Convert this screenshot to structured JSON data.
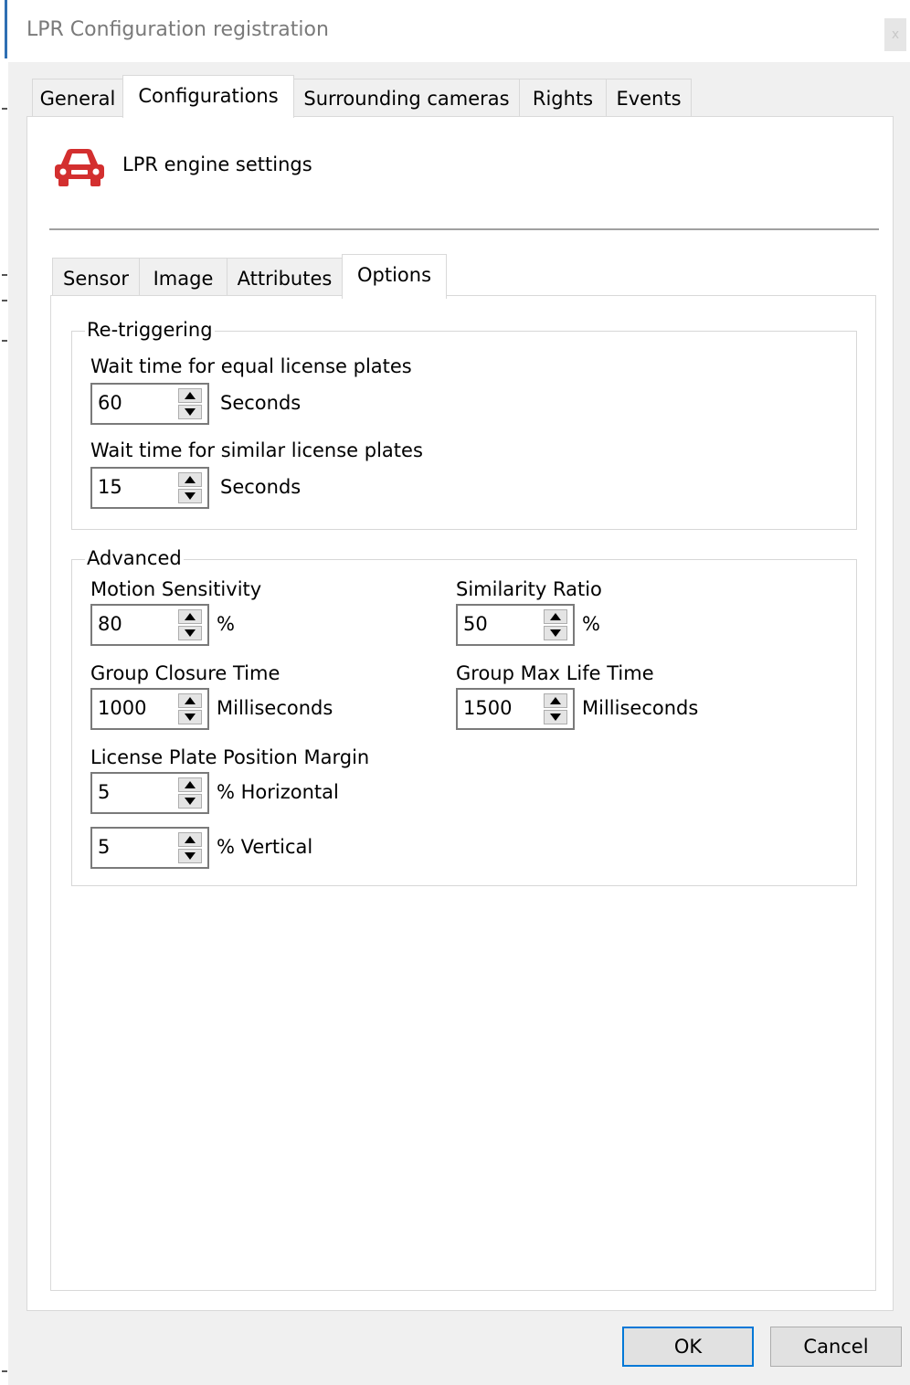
{
  "window": {
    "title": "LPR Configuration registration",
    "close_glyph": "x"
  },
  "outer_tabs": [
    "General",
    "Configurations",
    "Surrounding cameras",
    "Rights",
    "Events"
  ],
  "header": {
    "title": "LPR engine settings",
    "icon": "car-icon",
    "icon_color": "#d32f2f"
  },
  "inner_tabs": [
    "Sensor",
    "Image",
    "Attributes",
    "Options"
  ],
  "retriggering": {
    "legend": "Re-triggering",
    "equal": {
      "label": "Wait time for equal license plates",
      "value": "60",
      "unit": "Seconds"
    },
    "similar": {
      "label": "Wait time for similar license plates",
      "value": "15",
      "unit": "Seconds"
    }
  },
  "advanced": {
    "legend": "Advanced",
    "motion_sensitivity": {
      "label": "Motion Sensitivity",
      "value": "80",
      "unit": "%"
    },
    "similarity_ratio": {
      "label": "Similarity Ratio",
      "value": "50",
      "unit": "%"
    },
    "group_closure_time": {
      "label": "Group Closure Time",
      "value": "1000",
      "unit": "Milliseconds"
    },
    "group_max_life_time": {
      "label": "Group Max Life Time",
      "value": "1500",
      "unit": "Milliseconds"
    },
    "plate_margin": {
      "label": "License Plate Position Margin",
      "horizontal": {
        "value": "5",
        "unit": "% Horizontal"
      },
      "vertical": {
        "value": "5",
        "unit": "% Vertical"
      }
    }
  },
  "buttons": {
    "ok": "OK",
    "cancel": "Cancel"
  },
  "colors": {
    "accent": "#0078d7",
    "car": "#d32f2f"
  }
}
